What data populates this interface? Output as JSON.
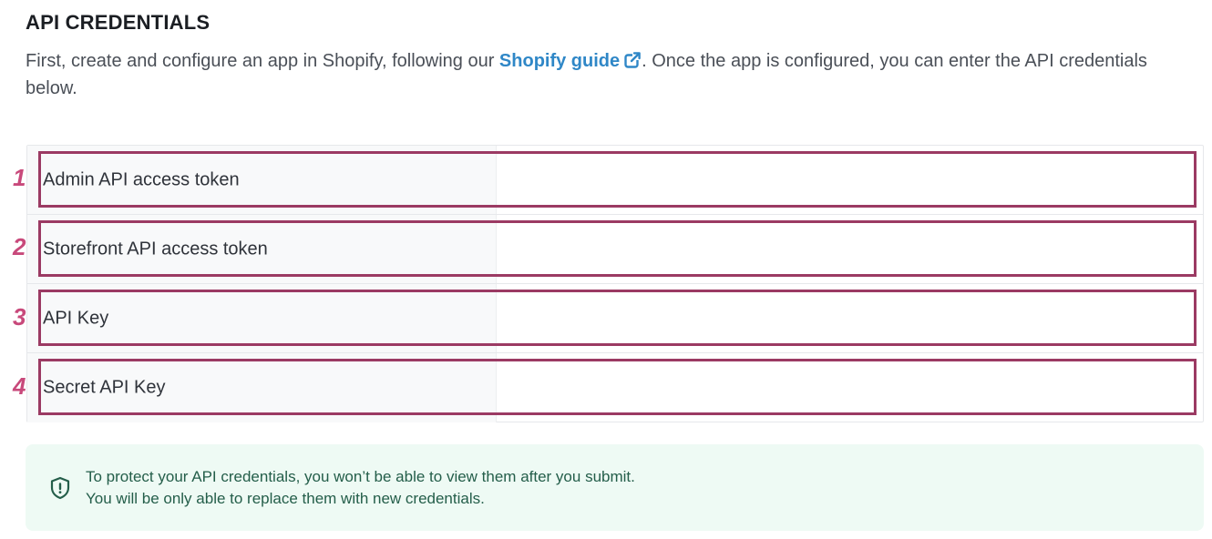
{
  "section": {
    "title": "API CREDENTIALS",
    "intro_before": "First, create and configure an app in Shopify, following our ",
    "guide_link": "Shopify guide",
    "intro_after": ". Once the app is configured, you can enter the API credentials below."
  },
  "credentials": {
    "rows": [
      {
        "number": "1",
        "label": "Admin API access token",
        "value": ""
      },
      {
        "number": "2",
        "label": "Storefront API access token",
        "value": ""
      },
      {
        "number": "3",
        "label": "API Key",
        "value": ""
      },
      {
        "number": "4",
        "label": "Secret API Key",
        "value": ""
      }
    ]
  },
  "notice": {
    "line1": "To protect your API credentials, you won’t be able to view them after you submit.",
    "line2": "You will be only able to replace them with new credentials."
  },
  "colors": {
    "link": "#2f87c7",
    "highlight_border": "#9b3a63",
    "row_number": "#c8497b",
    "notice_bg": "#eefaf4",
    "notice_text": "#245e4a"
  },
  "icons": {
    "external_link": "external-link-icon",
    "shield": "shield-alert-icon"
  }
}
